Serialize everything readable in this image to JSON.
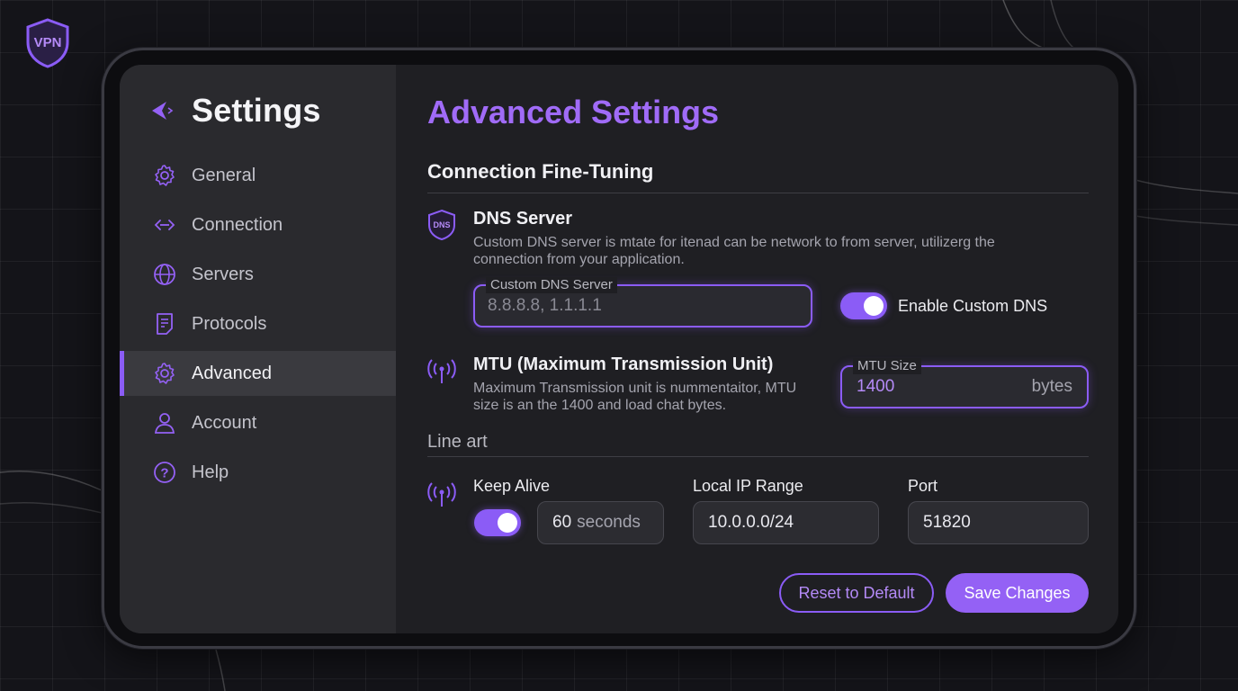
{
  "logo": {
    "text": "VPN",
    "icon": "shield-icon"
  },
  "sidebar": {
    "title": "Settings",
    "items": [
      {
        "label": "General",
        "icon": "gear-icon",
        "active": false
      },
      {
        "label": "Connection",
        "icon": "connection-icon",
        "active": false
      },
      {
        "label": "Servers",
        "icon": "globe-icon",
        "active": false
      },
      {
        "label": "Protocols",
        "icon": "document-icon",
        "active": false
      },
      {
        "label": "Advanced",
        "icon": "gear-icon",
        "active": true
      },
      {
        "label": "Account",
        "icon": "user-icon",
        "active": false
      },
      {
        "label": "Help",
        "icon": "help-icon",
        "active": false
      }
    ]
  },
  "main": {
    "title": "Advanced Settings",
    "section1": "Connection Fine-Tuning",
    "dns": {
      "badge": "DNS",
      "title": "DNS Server",
      "desc_line1": "Custom DNS server is mtate for itenad can be network to from server, utilizerg the",
      "desc_line2": "connection from your application.",
      "field_label": "Custom DNS Server",
      "field_placeholder": "8.8.8.8, 1.1.1.1",
      "toggle_label": "Enable Custom DNS",
      "toggle_on": true
    },
    "mtu": {
      "title": "MTU (Maximum Transmission Unit)",
      "desc_line1": "Maximum  Transmission unit is nummentaitor, MTU",
      "desc_line2": "size is an the 1400 and load chat bytes.",
      "field_label": "MTU Size",
      "value": "1400",
      "unit": "bytes"
    },
    "section2": "Line art",
    "keep_alive": {
      "label": "Keep Alive",
      "toggle_on": true,
      "value": "60",
      "unit": "seconds"
    },
    "local_ip": {
      "label": "Local IP Range",
      "value": "10.0.0.0/24"
    },
    "port": {
      "label": "Port",
      "value": "51820"
    },
    "buttons": {
      "reset": "Reset to Default",
      "save": "Save Changes"
    }
  },
  "colors": {
    "accent": "#8b5cf6",
    "title": "#a06bf7",
    "sidebar_bg": "#2a2a2e",
    "content_bg": "#1f1f23"
  }
}
